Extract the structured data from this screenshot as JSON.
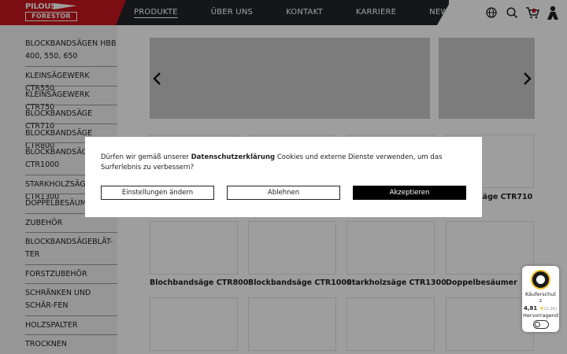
{
  "brand": {
    "logo_top": "PILOUS",
    "logo_bottom": "FORESTOR",
    "accent_color": "#c8161d"
  },
  "nav": {
    "items": [
      {
        "label": "PRODUKTE",
        "active": true
      },
      {
        "label": "ÜBER UNS"
      },
      {
        "label": "KONTAKT"
      },
      {
        "label": "KARRIERE"
      },
      {
        "label": "NEWS"
      }
    ],
    "icons": [
      "globe-icon",
      "search-icon",
      "cart-icon",
      "user-icon"
    ]
  },
  "sidebar": {
    "items": [
      {
        "label": "BLOCKBANDSÄGEN HBB 400, 550, 650"
      },
      {
        "label": "KLEINSÄGEWERK CTR550"
      },
      {
        "label": "KLEINSÄGEWERK CTR750"
      },
      {
        "label": "BLOCKBANDSÄGE CTR710"
      },
      {
        "label": "BLOCKBANDSÄGE CTR800"
      },
      {
        "label": "BLOCKBANDSÄGE CTR1000"
      },
      {
        "label": "STARKHOLZSÄGE CTR1300"
      },
      {
        "label": "DOPPELBESÄUMER"
      },
      {
        "label": "ZUBEHÖR"
      },
      {
        "label": "BLOCKBANDSÄGEBLÄT-TER"
      },
      {
        "label": "FORSTZUBEHÖR"
      },
      {
        "label": "SCHRÄNKEN UND SCHÄR-FEN"
      },
      {
        "label": "HOLZSPALTER"
      },
      {
        "label": "TROCKNEN"
      }
    ]
  },
  "products": {
    "row1_label_visible": "säge CTR710",
    "row2": [
      {
        "label": "Blochbandsäge CTR800"
      },
      {
        "label": "Blockbandsäge CTR1000"
      },
      {
        "label": "Starkholzsäge CTR1300"
      },
      {
        "label": "Doppelbesäumer"
      }
    ]
  },
  "carousel": {
    "prev_icon": "chevron-left-icon",
    "next_icon": "chevron-right-icon"
  },
  "cookie": {
    "text_before": "Dürfen wir gemäß unserer ",
    "link": "Datenschutzerklärung",
    "text_after": " Cookies und externe Dienste verwenden, um das Surferlebnis zu verbessern?",
    "btn_settings": "Einstellungen ändern",
    "btn_decline": "Ablehnen",
    "btn_accept": "Akzeptieren"
  },
  "trust_badge": {
    "title": "Käuferschutz",
    "rating": "4,81",
    "count": "(1.2k)",
    "verdict": "Hervorragend"
  }
}
